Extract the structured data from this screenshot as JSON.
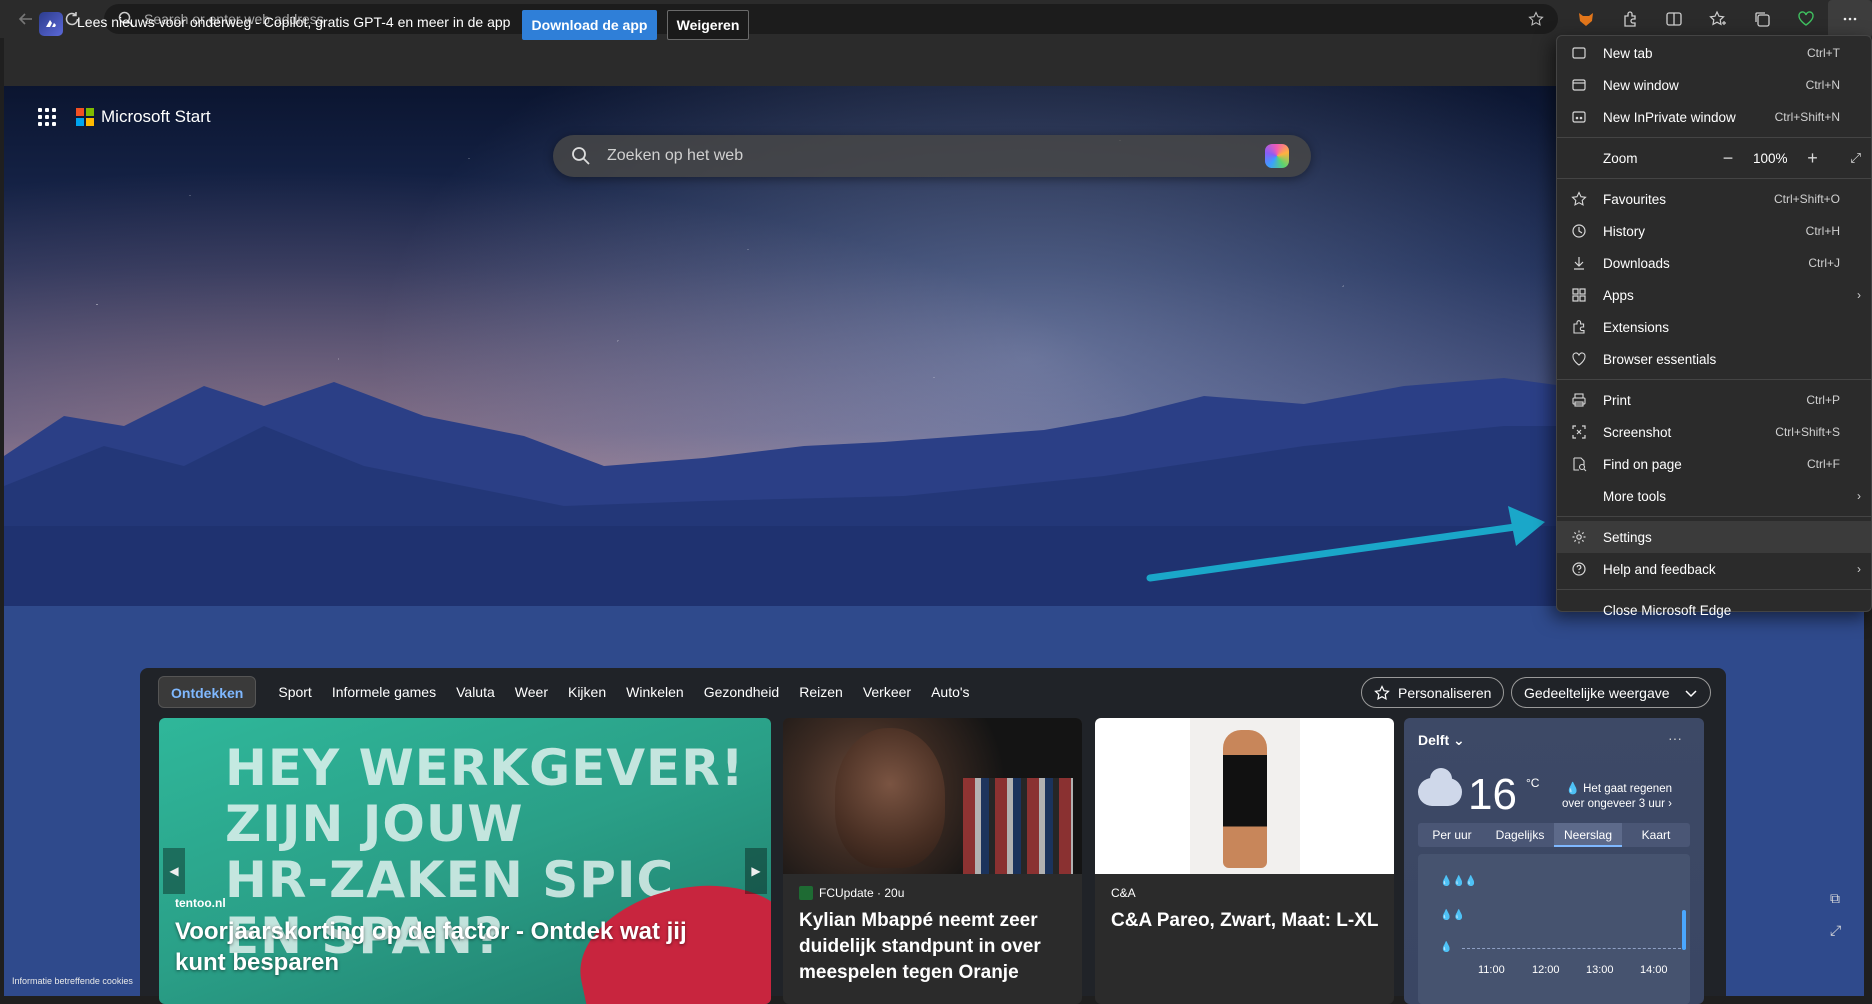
{
  "browser": {
    "address_placeholder": "Search or enter web address"
  },
  "notification": {
    "text": "Lees nieuws voor onderweg - Copilot, gratis GPT-4 en meer in de app",
    "primary": "Download de app",
    "secondary": "Weigeren"
  },
  "page": {
    "brand": "Microsoft Start",
    "search_placeholder": "Zoeken op het web",
    "cookies": "Informatie betreffende cookies"
  },
  "feed": {
    "tabs": [
      "Ontdekken",
      "Sport",
      "Informele games",
      "Valuta",
      "Weer",
      "Kijken",
      "Winkelen",
      "Gezondheid",
      "Reizen",
      "Verkeer",
      "Auto's"
    ],
    "personalize": "Personaliseren",
    "view": "Gedeeltelijke weergave",
    "card1": {
      "ad_text": [
        "HEY WERKGEVER!",
        "ZIJN JOUW",
        "HR-ZAKEN SPIC",
        "EN SPAN?"
      ],
      "source": "tentoo.nl",
      "title": "Voorjaarskorting op de factor - Ontdek wat jij kunt besparen"
    },
    "card2": {
      "source": "FCUpdate · 20u",
      "title": "Kylian Mbappé neemt zeer duidelijk standpunt in over meespelen tegen Oranje"
    },
    "card3": {
      "source": "C&A",
      "title": "C&A Pareo, Zwart, Maat: L-XL"
    }
  },
  "weather": {
    "city": "Delft",
    "more": "···",
    "temp": "16",
    "unit": "°C",
    "rain_note": "Het gaat regenen over ongeveer 3 uur",
    "tabs": [
      "Per uur",
      "Dagelijks",
      "Neerslag",
      "Kaart"
    ],
    "times": [
      "11:00",
      "12:00",
      "13:00",
      "14:00"
    ]
  },
  "menu": {
    "items": [
      {
        "label": "New tab",
        "key": "Ctrl+T"
      },
      {
        "label": "New window",
        "key": "Ctrl+N"
      },
      {
        "label": "New InPrivate window",
        "key": "Ctrl+Shift+N"
      },
      {
        "label": "Zoom",
        "value": "100%"
      },
      {
        "label": "Favourites",
        "key": "Ctrl+Shift+O"
      },
      {
        "label": "History",
        "key": "Ctrl+H"
      },
      {
        "label": "Downloads",
        "key": "Ctrl+J"
      },
      {
        "label": "Apps"
      },
      {
        "label": "Extensions"
      },
      {
        "label": "Browser essentials"
      },
      {
        "label": "Print",
        "key": "Ctrl+P"
      },
      {
        "label": "Screenshot",
        "key": "Ctrl+Shift+S"
      },
      {
        "label": "Find on page",
        "key": "Ctrl+F"
      },
      {
        "label": "More tools"
      },
      {
        "label": "Settings"
      },
      {
        "label": "Help and feedback"
      },
      {
        "label": "Close Microsoft Edge"
      }
    ]
  },
  "colors": {
    "accent": "#2f7fd8",
    "annotation_arrow": "#1aa7c9",
    "menu_bg": "#2b2b2b"
  }
}
